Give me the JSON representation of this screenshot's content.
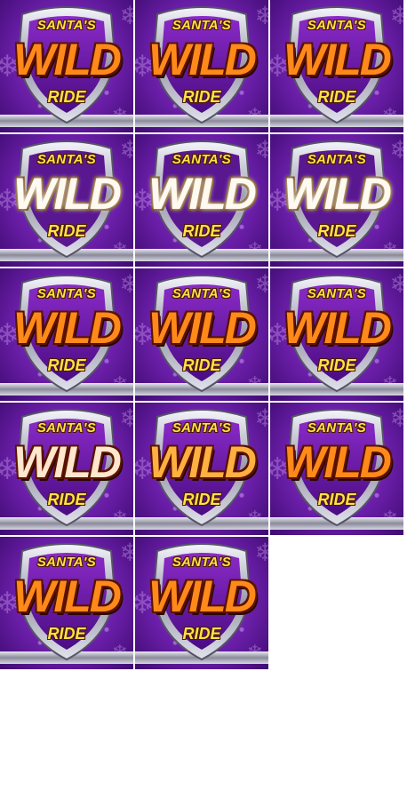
{
  "sprite_sheet": {
    "frame_text": {
      "line1": "SANTA'S",
      "line2": "WILD",
      "line3": "RIDE"
    },
    "frames": [
      {
        "variant": "hot"
      },
      {
        "variant": "hot"
      },
      {
        "variant": "hot"
      },
      {
        "variant": "flash"
      },
      {
        "variant": "flash"
      },
      {
        "variant": "flash"
      },
      {
        "variant": "hot"
      },
      {
        "variant": "hot"
      },
      {
        "variant": "hot"
      },
      {
        "variant": "pale"
      },
      {
        "variant": "warm"
      },
      {
        "variant": "hot"
      },
      {
        "variant": "hot"
      },
      {
        "variant": "hot"
      }
    ],
    "colors": {
      "background": "#ffffff",
      "tile_purple": "#6a1ea8",
      "text_gold": "#ffe14a",
      "wild_orange": "#ff8a1a",
      "shield_chrome": "#c8c8d4"
    }
  }
}
